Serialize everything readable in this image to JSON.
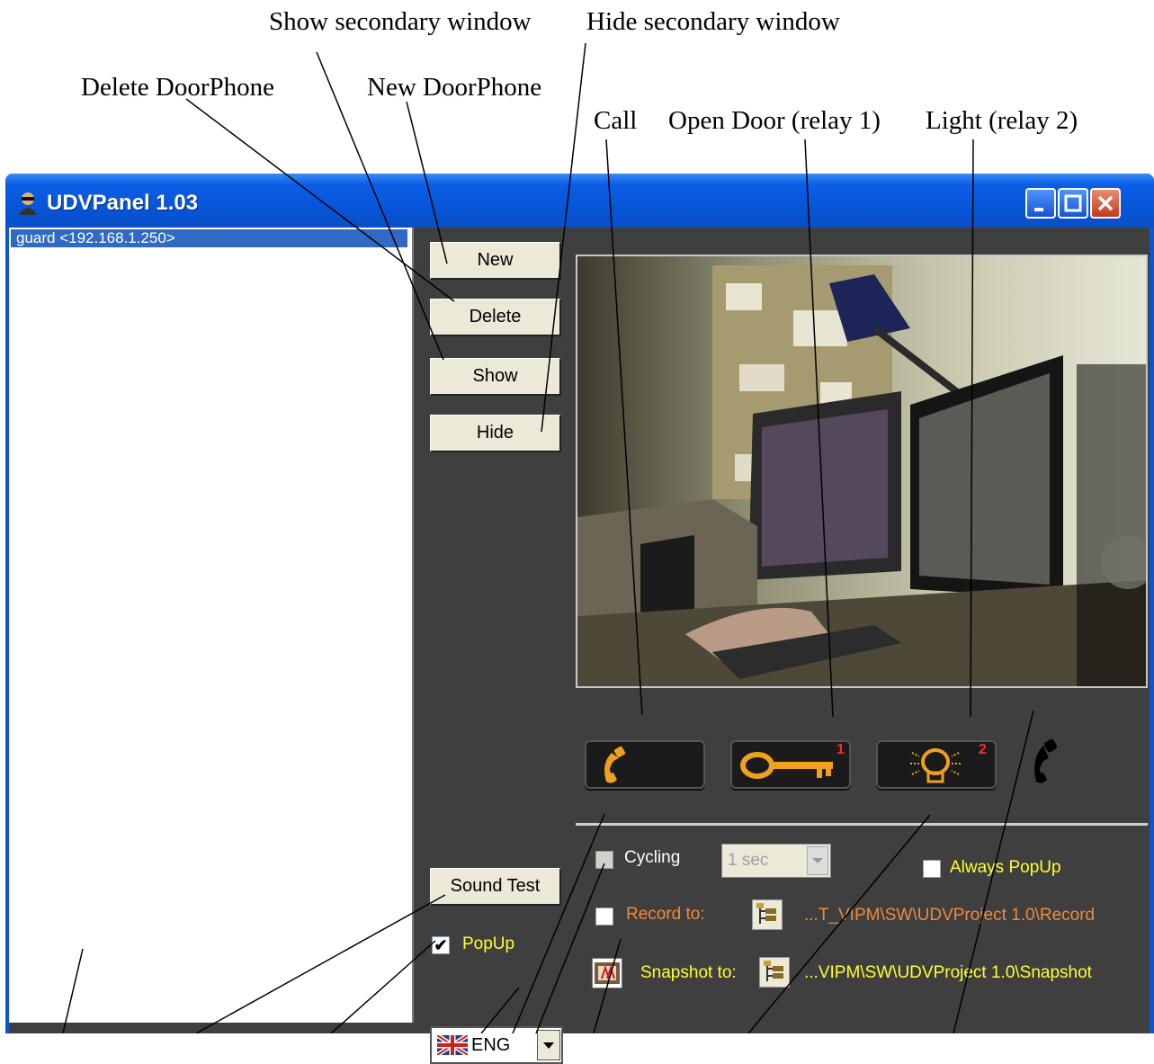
{
  "callouts": {
    "show_secondary": "Show secondary window",
    "hide_secondary": "Hide secondary window",
    "delete_doorphone": "Delete DoorPhone",
    "new_doorphone": "New DoorPhone",
    "call": "Call",
    "open_door": "Open Door (relay 1)",
    "light": "Light (relay 2)"
  },
  "window": {
    "title": "UDVPanel 1.03"
  },
  "device_list": {
    "items": [
      {
        "label": "guard <192.168.1.250>",
        "selected": true
      }
    ]
  },
  "buttons": {
    "new": "New",
    "delete": "Delete",
    "show": "Show",
    "hide": "Hide",
    "sound_test": "Sound Test"
  },
  "popup": {
    "label": "PopUp",
    "checked": true
  },
  "language": {
    "value": "ENG"
  },
  "controls": {
    "key_badge": "1",
    "light_badge": "2"
  },
  "settings": {
    "cycling_label": "Cycling",
    "cycling_checked": false,
    "cycling_interval": "1 sec",
    "always_popup_label": "Always PopUp",
    "always_popup_checked": false,
    "record_label": "Record to:",
    "record_checked": false,
    "record_path": "...T_VIPM\\SW\\UDVProject 1.0\\Record",
    "snapshot_label": "Snapshot to:",
    "snapshot_path": "...VIPM\\SW\\UDVProject 1.0\\Snapshot"
  },
  "colors": {
    "panel_bg": "#3f3f3f",
    "accent_orange": "#f08a3c",
    "accent_yellow": "#ffff33",
    "title_blue": "#0654d4",
    "selection_blue": "#316ac5"
  }
}
